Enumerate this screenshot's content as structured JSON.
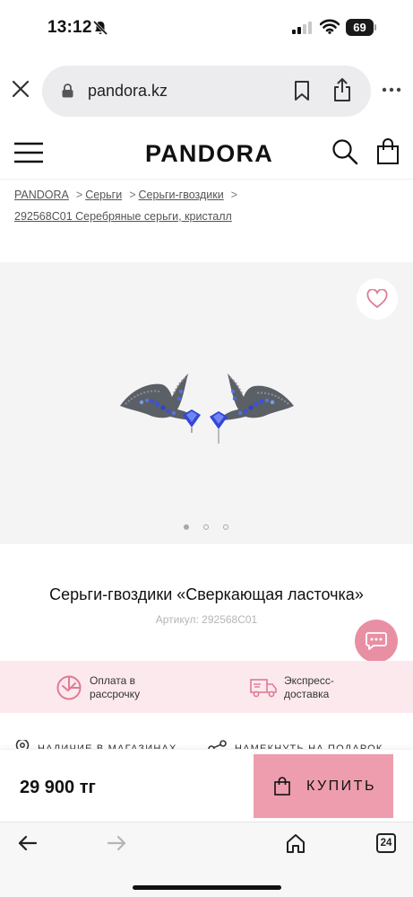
{
  "status_bar": {
    "time": "13:12",
    "battery": "69",
    "icons": [
      "mute-icon",
      "signal-icon",
      "wifi-icon",
      "battery-icon"
    ]
  },
  "browser": {
    "url": "pandora.kz",
    "icons": [
      "close-icon",
      "lock-icon",
      "bookmark-icon",
      "share-icon",
      "more-icon"
    ],
    "tab_count": "24",
    "toolbar_icons": [
      "back-icon",
      "forward-icon",
      "home-icon",
      "tabs-icon"
    ]
  },
  "header": {
    "brand": "PANDORA",
    "icons": [
      "menu-icon",
      "search-icon",
      "shopping-bag-icon"
    ]
  },
  "breadcrumb": {
    "items": [
      "PANDORA",
      "Серьги",
      "Серьги-гвоздики",
      "292568C01 Серебряные серьги, кристалл"
    ]
  },
  "gallery": {
    "slide_count": 3,
    "active_slide": 1,
    "image_alt": "swallow-earrings-image",
    "icons": [
      "heart-icon"
    ]
  },
  "product": {
    "title": "Серьги-гвоздики «Сверкающая ласточка»",
    "sku_label": "Артикул:",
    "sku": "292568C01"
  },
  "benefits": [
    {
      "icon": "installment-icon",
      "text": "Оплата в рассрочку"
    },
    {
      "icon": "delivery-truck-icon",
      "text": "Экспресс-доставка"
    }
  ],
  "partial_row": {
    "store_label": "НАЛИЧИЕ В МАГАЗИНАХ",
    "hint_label": "НАМЕКНУТЬ НА ПОДАРОК"
  },
  "buy_bar": {
    "price": "29 900 тг",
    "buy_label": "КУПИТЬ"
  },
  "colors": {
    "brand_pink": "#ee9dae",
    "chat_pink": "#e98fa4",
    "benefit_bg": "#fce9ee",
    "gallery_bg": "#f4f4f4",
    "earring_blue": "#3a53d6"
  }
}
